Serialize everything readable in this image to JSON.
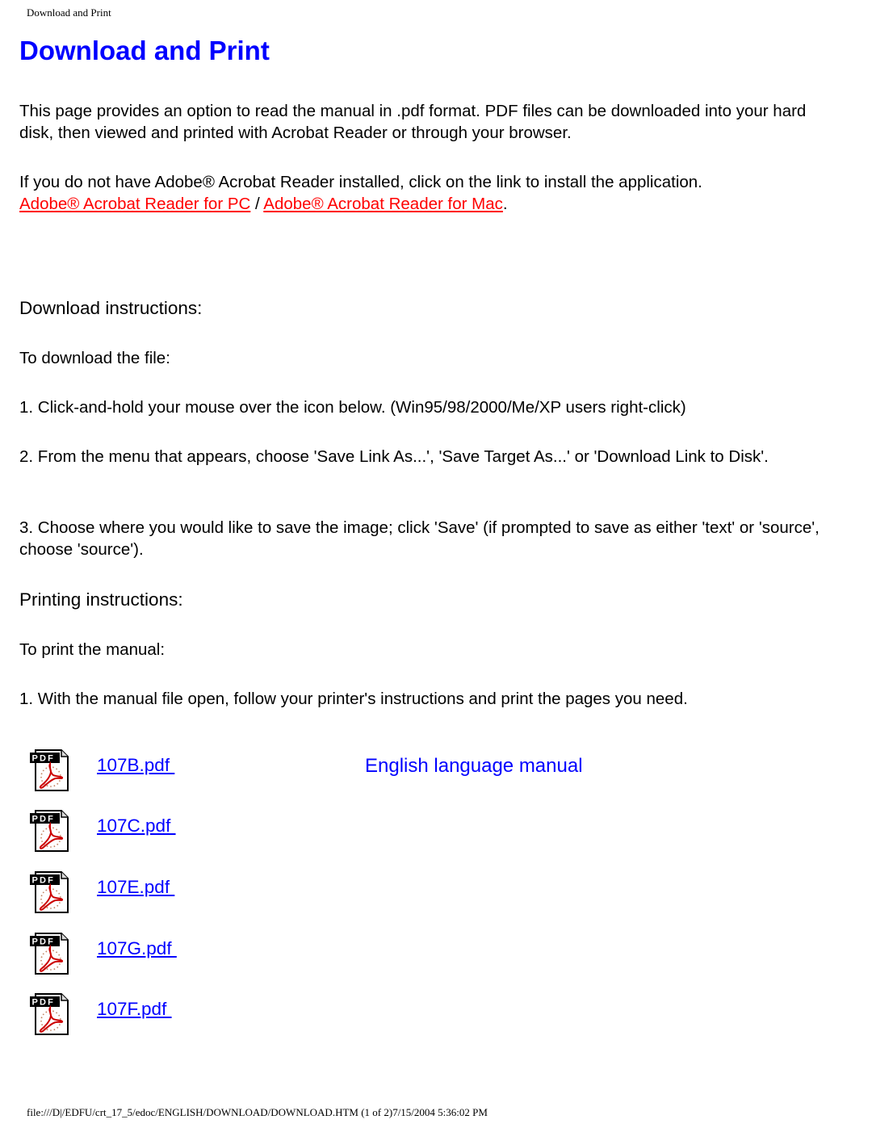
{
  "header": {
    "title": "Download and Print"
  },
  "page_title": "Download and Print",
  "intro": {
    "paragraph1": "This page provides an option to read the manual in .pdf format. PDF files can be downloaded into your hard disk, then viewed and printed with Acrobat Reader or through your browser.",
    "paragraph2": "If you do not have Adobe® Acrobat Reader installed, click on the link to install the application.",
    "link_pc": "Adobe® Acrobat Reader for PC",
    "separator": " / ",
    "link_mac": "Adobe® Acrobat Reader for Mac",
    "end": "."
  },
  "download": {
    "heading": "Download instructions:",
    "lead": "To download the file:",
    "steps": [
      "1. Click-and-hold your mouse over the icon below. (Win95/98/2000/Me/XP users right-click)",
      "2. From the menu that appears, choose 'Save Link As...', 'Save Target As...' or 'Download Link to Disk'.",
      "3. Choose where you would like to save the image; click 'Save' (if prompted to save as either 'text' or 'source', choose 'source')."
    ]
  },
  "printing": {
    "heading": "Printing instructions:",
    "lead": "To print the manual:",
    "steps": [
      "1. With the manual file open, follow your printer's instructions and print the pages you need."
    ]
  },
  "files": [
    {
      "name": "107B.pdf ",
      "icon": "pdf-file-icon",
      "description": "English language manual"
    },
    {
      "name": "107C.pdf ",
      "icon": "pdf-file-icon",
      "description": ""
    },
    {
      "name": "107E.pdf ",
      "icon": "pdf-file-icon",
      "description": ""
    },
    {
      "name": "107G.pdf ",
      "icon": "pdf-file-icon",
      "description": ""
    },
    {
      "name": "107F.pdf ",
      "icon": "pdf-file-icon",
      "description": ""
    }
  ],
  "colors": {
    "title": "#0000ff",
    "link": "#0000ff",
    "external_link": "#ff0000",
    "acrobat_red": "#cc0000"
  },
  "footer": {
    "text": "file:///D|/EDFU/crt_17_5/edoc/ENGLISH/DOWNLOAD/DOWNLOAD.HTM (1 of 2)7/15/2004 5:36:02 PM"
  }
}
